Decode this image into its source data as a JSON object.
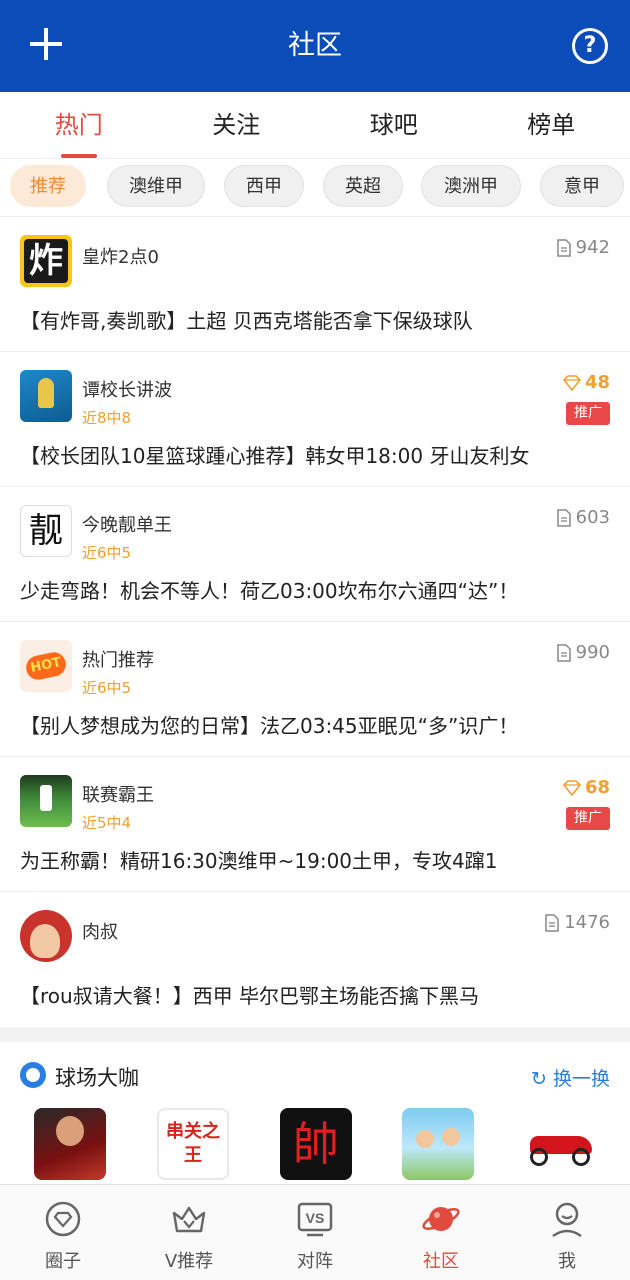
{
  "header": {
    "title": "社区",
    "help_label": "?"
  },
  "tabs": [
    {
      "label": "热门",
      "active": true
    },
    {
      "label": "关注"
    },
    {
      "label": "球吧"
    },
    {
      "label": "榜单"
    }
  ],
  "chips": [
    {
      "label": "推荐",
      "active": true
    },
    {
      "label": "澳维甲"
    },
    {
      "label": "西甲"
    },
    {
      "label": "英超"
    },
    {
      "label": "澳洲甲"
    },
    {
      "label": "意甲"
    }
  ],
  "posts": [
    {
      "user": "皇炸2点0",
      "record": "",
      "metric": "942",
      "metric_type": "doc",
      "promo": "",
      "title": "【有炸哥,奏凯歌】土超 贝西克塔能否拿下保级球队",
      "avatar_text": "炸"
    },
    {
      "user": "谭校长讲波",
      "record": "近8中8",
      "metric": "48",
      "metric_type": "diamond",
      "promo": "推广",
      "title": "【校长团队10星篮球踵心推荐】韩女甲18:00 牙山友利女",
      "avatar_text": ""
    },
    {
      "user": "今晚靓单王",
      "record": "近6中5",
      "metric": "603",
      "metric_type": "doc",
      "promo": "",
      "title": "少走弯路！机会不等人！荷乙03:00坎布尔六通四“达”！",
      "avatar_text": "靓"
    },
    {
      "user": "热门推荐",
      "record": "近6中5",
      "metric": "990",
      "metric_type": "doc",
      "promo": "",
      "title": "【别人梦想成为您的日常】法乙03:45亚眠见“多”识广！",
      "avatar_text": "HOT"
    },
    {
      "user": "联赛霸王",
      "record": "近5中4",
      "metric": "68",
      "metric_type": "diamond",
      "promo": "推广",
      "title": "为王称霸！精研16:30澳维甲~19:00土甲，专攻4蹿1",
      "avatar_text": ""
    },
    {
      "user": "肉叔",
      "record": "",
      "metric": "1476",
      "metric_type": "doc",
      "promo": "",
      "title": "【rou叔请大餐！】西甲 毕尔巴鄂主场能否擒下黑马",
      "avatar_text": ""
    }
  ],
  "section": {
    "title": "球场大咖",
    "swap_label": "换一换",
    "thumbs": [
      {
        "name": "player-photo",
        "text": ""
      },
      {
        "name": "chuanguan-logo",
        "text": "串关之王"
      },
      {
        "name": "shuai-logo",
        "text": "帥"
      },
      {
        "name": "cartoon-kids",
        "text": ""
      },
      {
        "name": "motorcycle",
        "text": ""
      }
    ]
  },
  "bottom_nav": [
    {
      "label": "圈子",
      "icon": "circle-icon"
    },
    {
      "label": "V推荐",
      "icon": "crown-icon"
    },
    {
      "label": "对阵",
      "icon": "vs-icon"
    },
    {
      "label": "社区",
      "icon": "planet-icon",
      "active": true
    },
    {
      "label": "我",
      "icon": "user-icon"
    }
  ],
  "colors": {
    "primary": "#0b4cb8",
    "accent": "#e04a3f",
    "gold": "#f0a030",
    "link": "#2a7de1"
  }
}
